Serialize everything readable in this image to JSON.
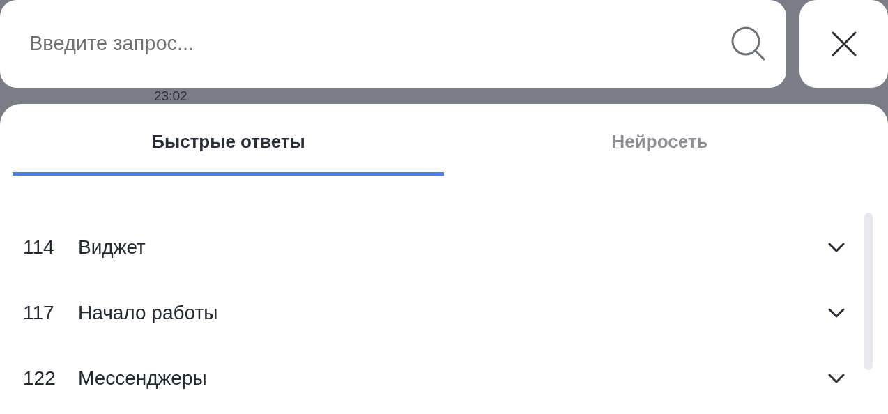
{
  "background": {
    "time": "23:02"
  },
  "search": {
    "placeholder": "Введите запрос..."
  },
  "tabs": [
    {
      "label": "Быстрые ответы",
      "selected": true
    },
    {
      "label": "Нейросеть",
      "selected": false
    }
  ],
  "groups": [
    {
      "number": "114",
      "title": "Виджет",
      "expanded": false
    },
    {
      "number": "117",
      "title": "Начало работы",
      "expanded": false
    },
    {
      "number": "122",
      "title": "Мессенджеры",
      "expanded": false
    }
  ]
}
